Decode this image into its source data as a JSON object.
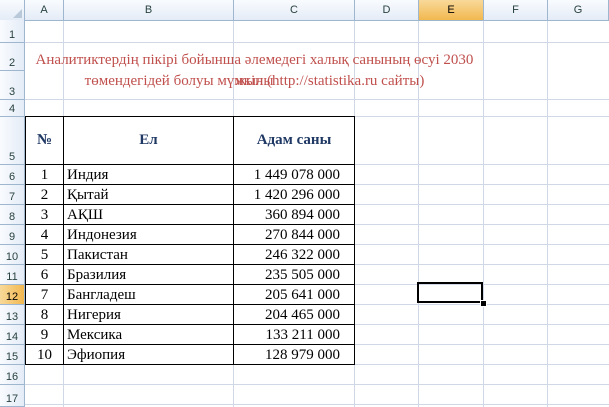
{
  "sheet": {
    "columns": [
      "A",
      "B",
      "C",
      "D",
      "E",
      "F",
      "G"
    ],
    "active_column": "E",
    "rows": [
      "1",
      "2",
      "3",
      "4",
      "5",
      "6",
      "7",
      "8",
      "9",
      "10",
      "11",
      "12",
      "13",
      "14",
      "15",
      "16",
      "17"
    ],
    "active_row": "12"
  },
  "title": {
    "line1": "Аналитиктердің пікірі бойынша әлемедегі халық санының өсуі 2030 жылы",
    "line2": "төмендегідей болуы мүмкін (http://statistika.ru сайты)",
    "color": "#c0504d"
  },
  "table": {
    "headers": [
      "№",
      "Ел",
      "Адам саны"
    ],
    "rows": [
      [
        "1",
        "Индия",
        "1 449 078 000"
      ],
      [
        "2",
        "Қытай",
        "1 420 296 000"
      ],
      [
        "3",
        "АҚШ",
        "360 894 000"
      ],
      [
        "4",
        "Индонезия",
        "270 844 000"
      ],
      [
        "5",
        "Пакистан",
        "246 322 000"
      ],
      [
        "6",
        "Бразилия",
        "235 505 000"
      ],
      [
        "7",
        "Бангладеш",
        "205 641 000"
      ],
      [
        "8",
        "Нигерия",
        "204 465 000"
      ],
      [
        "9",
        "Мексика",
        "133 211 000"
      ],
      [
        "10",
        "Эфиопия",
        "128 979 000"
      ]
    ]
  }
}
